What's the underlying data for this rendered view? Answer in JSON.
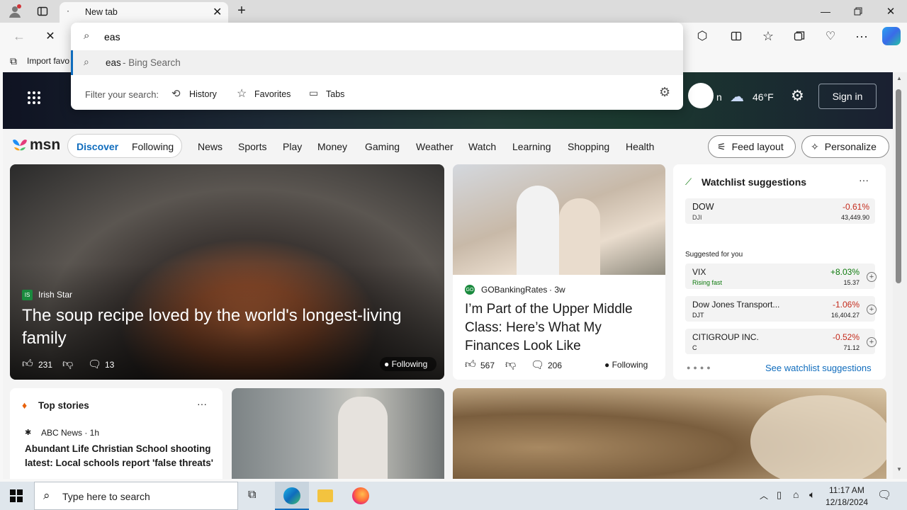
{
  "browser": {
    "tab_title": "New tab",
    "address_value": "eas",
    "favorites_import": "Import favo",
    "suggestion": {
      "query": "eas",
      "source": " - Bing Search"
    },
    "filter": {
      "label": "Filter your search:",
      "history": "History",
      "favorites": "Favorites",
      "tabs": "Tabs"
    }
  },
  "msn": {
    "logo": "msn",
    "weather": {
      "location_fragment": "n",
      "temp": "46°F"
    },
    "sign_in": "Sign in",
    "tabs": [
      "Discover",
      "Following"
    ],
    "nav": [
      "News",
      "Sports",
      "Play",
      "Money",
      "Gaming",
      "Weather",
      "Watch",
      "Learning",
      "Shopping",
      "Health"
    ],
    "feed_layout": "Feed layout",
    "personalize": "Personalize",
    "hero": {
      "source": "Irish Star",
      "headline": "The soup recipe loved by the world's longest-living family",
      "likes": "231",
      "comments": "13",
      "following": "Following"
    },
    "story2": {
      "source": "GOBankingRates",
      "age": "· 3w",
      "headline": "I’m Part of the Upper Middle Class: Here’s What My Finances Look Like",
      "likes": "567",
      "comments": "206",
      "following": "Following"
    },
    "watchlist": {
      "title": "Watchlist suggestions",
      "main": {
        "name": "DOW",
        "symbol": "DJI",
        "change": "-0.61%",
        "value": "43,449.90"
      },
      "suggested_label": "Suggested for you",
      "items": [
        {
          "name": "VIX",
          "sub": "Rising fast",
          "change": "+8.03%",
          "value": "15.37"
        },
        {
          "name": "Dow Jones Transport...",
          "sub": "DJT",
          "change": "-1.06%",
          "value": "16,404.27"
        },
        {
          "name": "CITIGROUP INC.",
          "sub": "C",
          "change": "-0.52%",
          "value": "71.12"
        }
      ],
      "see_more": "See watchlist suggestions"
    },
    "top_stories": {
      "title": "Top stories",
      "source": "ABC News · 1h",
      "headline": "Abundant Life Christian School shooting latest: Local schools report 'false threats'"
    }
  },
  "taskbar": {
    "search_placeholder": "Type here to search",
    "time": "11:17 AM",
    "date": "12/18/2024"
  },
  "colors": {
    "accent": "#0f6cbd",
    "negative": "#c42b1c",
    "positive": "#0e7a0d"
  }
}
